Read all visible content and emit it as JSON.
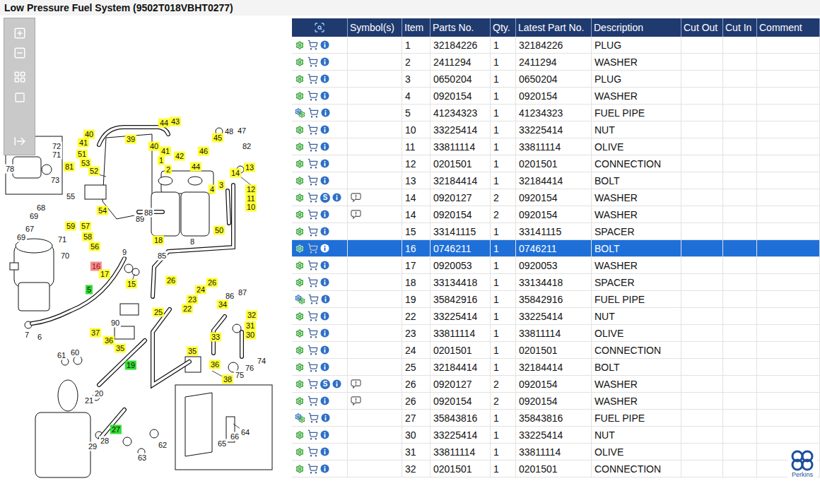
{
  "window": {
    "title": "Low Pressure Fuel System (9502T018VBHT0277)"
  },
  "diagram": {
    "callouts": [
      {
        "label": "40",
        "color": "#ffff33"
      },
      {
        "label": "41",
        "color": "#ffff33"
      },
      {
        "label": "51",
        "color": "#ffff33"
      },
      {
        "label": "53",
        "color": "#ffff33"
      },
      {
        "label": "52",
        "color": "#ffff33"
      },
      {
        "label": "81",
        "color": "#ffff33"
      },
      {
        "label": "39",
        "color": "#ffff33"
      },
      {
        "label": "44",
        "color": "#ffff33"
      },
      {
        "label": "43",
        "color": "#ffff33"
      },
      {
        "label": "40",
        "color": "#ffff33"
      },
      {
        "label": "41",
        "color": "#ffff33"
      },
      {
        "label": "42",
        "color": "#ffff33"
      },
      {
        "label": "44",
        "color": "#ffff33"
      },
      {
        "label": "1",
        "color": "#ffff33"
      },
      {
        "label": "2",
        "color": "#ffff33"
      },
      {
        "label": "45",
        "color": "#ffff33"
      },
      {
        "label": "46",
        "color": "#ffff33"
      },
      {
        "label": "48",
        "color": "#ffffff"
      },
      {
        "label": "47",
        "color": "#ffffff"
      },
      {
        "label": "82",
        "color": "#ffffff"
      },
      {
        "label": "13",
        "color": "#ffff33"
      },
      {
        "label": "14",
        "color": "#ffff33"
      },
      {
        "label": "4",
        "color": "#ffff33"
      },
      {
        "label": "3",
        "color": "#ffff33"
      },
      {
        "label": "12",
        "color": "#ffff33"
      },
      {
        "label": "11",
        "color": "#ffff33"
      },
      {
        "label": "10",
        "color": "#ffff33"
      },
      {
        "label": "72",
        "color": "#ffffff"
      },
      {
        "label": "71",
        "color": "#ffffff"
      },
      {
        "label": "78",
        "color": "#ffffff"
      },
      {
        "label": "73",
        "color": "#ffffff"
      },
      {
        "label": "55",
        "color": "#ffffff"
      },
      {
        "label": "54",
        "color": "#ffff33"
      },
      {
        "label": "68",
        "color": "#ffffff"
      },
      {
        "label": "69",
        "color": "#ffffff"
      },
      {
        "label": "59",
        "color": "#ffff33"
      },
      {
        "label": "57",
        "color": "#ffff33"
      },
      {
        "label": "58",
        "color": "#ffff33"
      },
      {
        "label": "56",
        "color": "#ffff33"
      },
      {
        "label": "67",
        "color": "#ffffff"
      },
      {
        "label": "69",
        "color": "#ffffff"
      },
      {
        "label": "71",
        "color": "#ffffff"
      },
      {
        "label": "70",
        "color": "#ffffff"
      },
      {
        "label": "9",
        "color": "#ffffff"
      },
      {
        "label": "16",
        "color": "#f28c8c"
      },
      {
        "label": "17",
        "color": "#ffff33"
      },
      {
        "label": "15",
        "color": "#ffff33"
      },
      {
        "label": "89",
        "color": "#ffffff"
      },
      {
        "label": "88",
        "color": "#ffffff"
      },
      {
        "label": "18",
        "color": "#ffff33"
      },
      {
        "label": "8",
        "color": "#ffffff"
      },
      {
        "label": "85",
        "color": "#ffffff"
      },
      {
        "label": "50",
        "color": "#ffff33"
      },
      {
        "label": "5",
        "color": "#33dd33"
      },
      {
        "label": "26",
        "color": "#ffff33"
      },
      {
        "label": "26",
        "color": "#ffff33"
      },
      {
        "label": "24",
        "color": "#ffff33"
      },
      {
        "label": "23",
        "color": "#ffff33"
      },
      {
        "label": "22",
        "color": "#ffff33"
      },
      {
        "label": "25",
        "color": "#ffff33"
      },
      {
        "label": "86",
        "color": "#ffffff"
      },
      {
        "label": "87",
        "color": "#ffffff"
      },
      {
        "label": "34",
        "color": "#ffff33"
      },
      {
        "label": "32",
        "color": "#ffff33"
      },
      {
        "label": "31",
        "color": "#ffff33"
      },
      {
        "label": "30",
        "color": "#ffff33"
      },
      {
        "label": "33",
        "color": "#ffff33"
      },
      {
        "label": "90",
        "color": "#ffffff"
      },
      {
        "label": "37",
        "color": "#ffff33"
      },
      {
        "label": "36",
        "color": "#ffff33"
      },
      {
        "label": "35",
        "color": "#ffff33"
      },
      {
        "label": "7",
        "color": "#ffffff"
      },
      {
        "label": "6",
        "color": "#ffffff"
      },
      {
        "label": "35",
        "color": "#ffff33"
      },
      {
        "label": "19",
        "color": "#33dd33"
      },
      {
        "label": "36",
        "color": "#ffff33"
      },
      {
        "label": "38",
        "color": "#ffff33"
      },
      {
        "label": "76",
        "color": "#ffffff"
      },
      {
        "label": "75",
        "color": "#ffffff"
      },
      {
        "label": "74",
        "color": "#ffffff"
      },
      {
        "label": "61",
        "color": "#ffffff"
      },
      {
        "label": "60",
        "color": "#ffffff"
      },
      {
        "label": "20",
        "color": "#ffffff"
      },
      {
        "label": "21",
        "color": "#ffffff"
      },
      {
        "label": "27",
        "color": "#33dd33"
      },
      {
        "label": "28",
        "color": "#ffffff"
      },
      {
        "label": "29",
        "color": "#ffffff"
      },
      {
        "label": "62",
        "color": "#ffffff"
      },
      {
        "label": "63",
        "color": "#ffffff"
      },
      {
        "label": "64",
        "color": "#ffffff"
      },
      {
        "label": "65",
        "color": "#ffffff"
      },
      {
        "label": "66",
        "color": "#ffffff"
      }
    ]
  },
  "table": {
    "columns": [
      "Symbol(s)",
      "Item",
      "Parts No.",
      "Qty.",
      "Latest Part No.",
      "Description",
      "Cut Out",
      "Cut In",
      "Comment"
    ],
    "rows": [
      {
        "item": "1",
        "parts_no": "32184226",
        "qty": "1",
        "latest": "32184226",
        "description": "PLUG",
        "assembly": false,
        "badge": "",
        "note": false,
        "selected": false
      },
      {
        "item": "2",
        "parts_no": "2411294",
        "qty": "1",
        "latest": "2411294",
        "description": "WASHER",
        "assembly": false,
        "badge": "",
        "note": false,
        "selected": false
      },
      {
        "item": "3",
        "parts_no": "0650204",
        "qty": "1",
        "latest": "0650204",
        "description": "PLUG",
        "assembly": false,
        "badge": "",
        "note": false,
        "selected": false
      },
      {
        "item": "4",
        "parts_no": "0920154",
        "qty": "1",
        "latest": "0920154",
        "description": "WASHER",
        "assembly": false,
        "badge": "",
        "note": false,
        "selected": false
      },
      {
        "item": "5",
        "parts_no": "41234323",
        "qty": "1",
        "latest": "41234323",
        "description": "FUEL PIPE",
        "assembly": true,
        "badge": "",
        "note": false,
        "selected": false
      },
      {
        "item": "10",
        "parts_no": "33225414",
        "qty": "1",
        "latest": "33225414",
        "description": "NUT",
        "assembly": false,
        "badge": "",
        "note": false,
        "selected": false
      },
      {
        "item": "11",
        "parts_no": "33811114",
        "qty": "1",
        "latest": "33811114",
        "description": "OLIVE",
        "assembly": false,
        "badge": "",
        "note": false,
        "selected": false
      },
      {
        "item": "12",
        "parts_no": "0201501",
        "qty": "1",
        "latest": "0201501",
        "description": "CONNECTION",
        "assembly": false,
        "badge": "",
        "note": false,
        "selected": false
      },
      {
        "item": "13",
        "parts_no": "32184414",
        "qty": "1",
        "latest": "32184414",
        "description": "BOLT",
        "assembly": false,
        "badge": "",
        "note": false,
        "selected": false
      },
      {
        "item": "14",
        "parts_no": "0920127",
        "qty": "2",
        "latest": "0920154",
        "description": "WASHER",
        "assembly": false,
        "badge": "S",
        "note": true,
        "selected": false
      },
      {
        "item": "14",
        "parts_no": "0920154",
        "qty": "2",
        "latest": "0920154",
        "description": "WASHER",
        "assembly": false,
        "badge": "",
        "note": true,
        "selected": false
      },
      {
        "item": "15",
        "parts_no": "33141115",
        "qty": "1",
        "latest": "33141115",
        "description": "SPACER",
        "assembly": false,
        "badge": "",
        "note": false,
        "selected": false
      },
      {
        "item": "16",
        "parts_no": "0746211",
        "qty": "1",
        "latest": "0746211",
        "description": "BOLT",
        "assembly": false,
        "badge": "",
        "note": false,
        "selected": true
      },
      {
        "item": "17",
        "parts_no": "0920053",
        "qty": "1",
        "latest": "0920053",
        "description": "WASHER",
        "assembly": false,
        "badge": "",
        "note": false,
        "selected": false
      },
      {
        "item": "18",
        "parts_no": "33134418",
        "qty": "1",
        "latest": "33134418",
        "description": "SPACER",
        "assembly": false,
        "badge": "",
        "note": false,
        "selected": false
      },
      {
        "item": "19",
        "parts_no": "35842916",
        "qty": "1",
        "latest": "35842916",
        "description": "FUEL PIPE",
        "assembly": true,
        "badge": "",
        "note": false,
        "selected": false
      },
      {
        "item": "22",
        "parts_no": "33225414",
        "qty": "1",
        "latest": "33225414",
        "description": "NUT",
        "assembly": false,
        "badge": "",
        "note": false,
        "selected": false
      },
      {
        "item": "23",
        "parts_no": "33811114",
        "qty": "1",
        "latest": "33811114",
        "description": "OLIVE",
        "assembly": false,
        "badge": "",
        "note": false,
        "selected": false
      },
      {
        "item": "24",
        "parts_no": "0201501",
        "qty": "1",
        "latest": "0201501",
        "description": "CONNECTION",
        "assembly": false,
        "badge": "",
        "note": false,
        "selected": false
      },
      {
        "item": "25",
        "parts_no": "32184414",
        "qty": "1",
        "latest": "32184414",
        "description": "BOLT",
        "assembly": false,
        "badge": "",
        "note": false,
        "selected": false
      },
      {
        "item": "26",
        "parts_no": "0920127",
        "qty": "2",
        "latest": "0920154",
        "description": "WASHER",
        "assembly": false,
        "badge": "S",
        "note": true,
        "selected": false
      },
      {
        "item": "26",
        "parts_no": "0920154",
        "qty": "2",
        "latest": "0920154",
        "description": "WASHER",
        "assembly": false,
        "badge": "",
        "note": true,
        "selected": false
      },
      {
        "item": "27",
        "parts_no": "35843816",
        "qty": "1",
        "latest": "35843816",
        "description": "FUEL PIPE",
        "assembly": true,
        "badge": "",
        "note": false,
        "selected": false
      },
      {
        "item": "30",
        "parts_no": "33225414",
        "qty": "1",
        "latest": "33225414",
        "description": "NUT",
        "assembly": false,
        "badge": "",
        "note": false,
        "selected": false
      },
      {
        "item": "31",
        "parts_no": "33811114",
        "qty": "1",
        "latest": "33811114",
        "description": "OLIVE",
        "assembly": false,
        "badge": "",
        "note": false,
        "selected": false
      },
      {
        "item": "32",
        "parts_no": "0201501",
        "qty": "1",
        "latest": "0201501",
        "description": "CONNECTION",
        "assembly": false,
        "badge": "",
        "note": false,
        "selected": false
      }
    ]
  },
  "logo": {
    "text": "Perkins"
  }
}
